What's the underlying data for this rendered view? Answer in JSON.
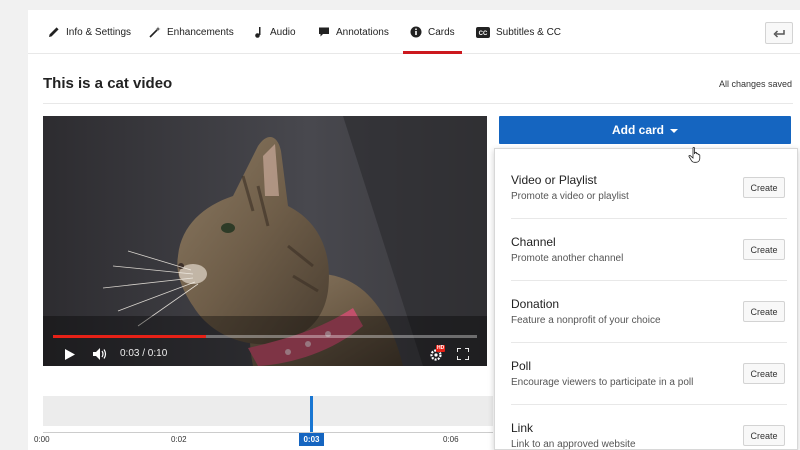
{
  "tabs": [
    {
      "label": "Info & Settings",
      "icon": "pencil-icon"
    },
    {
      "label": "Enhancements",
      "icon": "magic-wand-icon"
    },
    {
      "label": "Audio",
      "icon": "music-note-icon"
    },
    {
      "label": "Annotations",
      "icon": "speech-bubble-icon"
    },
    {
      "label": "Cards",
      "icon": "info-circle-icon",
      "active": true
    },
    {
      "label": "Subtitles & CC",
      "icon": "cc-icon"
    }
  ],
  "page": {
    "title": "This is a cat video",
    "status": "All changes saved"
  },
  "video": {
    "time": "0:03 / 0:10",
    "progress": 0.36,
    "hd_badge": "HD"
  },
  "timeline": {
    "ticks": [
      "0:00",
      "0:02",
      "0:06"
    ],
    "playhead": "0:03"
  },
  "cards": {
    "add_label": "Add card",
    "create_label": "Create",
    "options": [
      {
        "name": "Video or Playlist",
        "desc": "Promote a video or playlist"
      },
      {
        "name": "Channel",
        "desc": "Promote another channel"
      },
      {
        "name": "Donation",
        "desc": "Feature a nonprofit of your choice"
      },
      {
        "name": "Poll",
        "desc": "Encourage viewers to participate in a poll"
      },
      {
        "name": "Link",
        "desc": "Link to an approved website"
      }
    ]
  },
  "colors": {
    "accent": "#1565c0",
    "tab_underline": "#cc181e",
    "progress": "#e62117"
  }
}
